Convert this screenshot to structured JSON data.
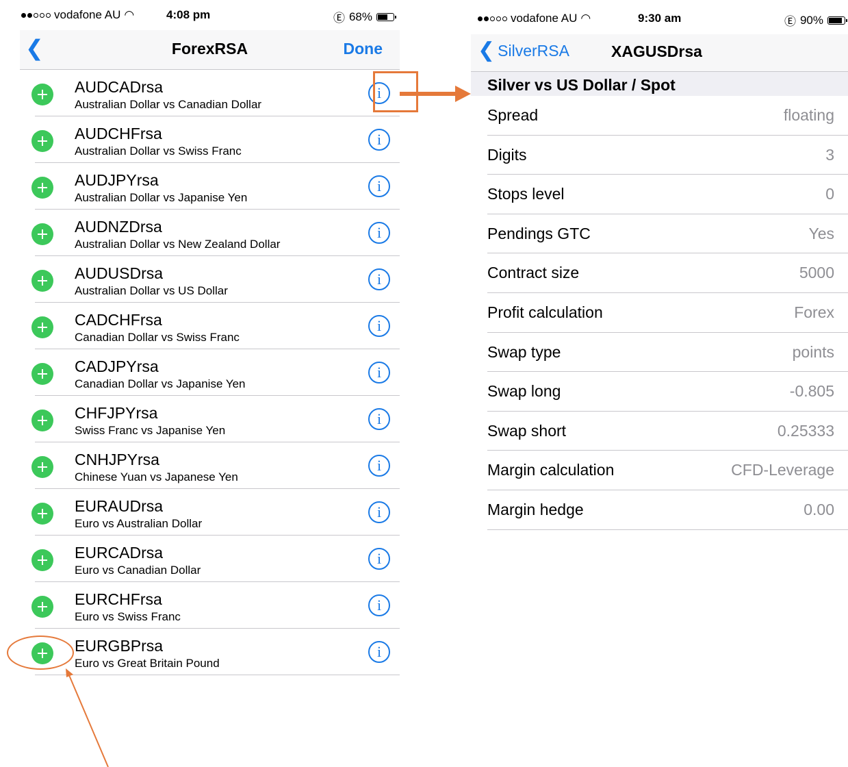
{
  "colors": {
    "accent": "#1a7ae6",
    "add_green": "#3cc85a",
    "annotation": "#e5793a",
    "value_gray": "#8e8e93"
  },
  "left_screen": {
    "status": {
      "carrier": "vodafone AU",
      "time": "4:08 pm",
      "battery": "68%",
      "battery_level": 0.68
    },
    "nav": {
      "back_icon": "chevron-left-icon",
      "title": "ForexRSA",
      "done_label": "Done"
    },
    "items": [
      {
        "symbol": "AUDCADrsa",
        "description": "Australian Dollar vs Canadian Dollar"
      },
      {
        "symbol": "AUDCHFrsa",
        "description": "Australian Dollar vs Swiss Franc"
      },
      {
        "symbol": "AUDJPYrsa",
        "description": "Australian Dollar vs Japanise Yen"
      },
      {
        "symbol": "AUDNZDrsa",
        "description": "Australian Dollar vs New Zealand Dollar"
      },
      {
        "symbol": "AUDUSDrsa",
        "description": "Australian Dollar vs US Dollar"
      },
      {
        "symbol": "CADCHFrsa",
        "description": "Canadian Dollar vs Swiss Franc"
      },
      {
        "symbol": "CADJPYrsa",
        "description": "Canadian Dollar vs Japanise Yen"
      },
      {
        "symbol": "CHFJPYrsa",
        "description": "Swiss Franc vs Japanise Yen"
      },
      {
        "symbol": "CNHJPYrsa",
        "description": "Chinese Yuan vs Japanese Yen"
      },
      {
        "symbol": "EURAUDrsa",
        "description": "Euro vs Australian Dollar"
      },
      {
        "symbol": "EURCADrsa",
        "description": "Euro vs Canadian Dollar"
      },
      {
        "symbol": "EURCHFrsa",
        "description": "Euro vs Swiss Franc"
      },
      {
        "symbol": "EURGBPrsa",
        "description": "Euro vs Great Britain Pound"
      }
    ],
    "info_glyph": "i"
  },
  "right_screen": {
    "status": {
      "carrier": "vodafone AU",
      "time": "9:30 am",
      "battery": "90%",
      "battery_level": 0.9
    },
    "nav": {
      "back_label": "SilverRSA",
      "title": "XAGUSDrsa"
    },
    "section_title": "Silver vs US Dollar / Spot",
    "properties": [
      {
        "label": "Spread",
        "value": "floating"
      },
      {
        "label": "Digits",
        "value": "3"
      },
      {
        "label": "Stops level",
        "value": "0"
      },
      {
        "label": "Pendings GTC",
        "value": "Yes"
      },
      {
        "label": "Contract size",
        "value": "5000"
      },
      {
        "label": "Profit calculation",
        "value": "Forex"
      },
      {
        "label": "Swap type",
        "value": "points"
      },
      {
        "label": "Swap long",
        "value": "-0.805"
      },
      {
        "label": "Swap short",
        "value": "0.25333"
      },
      {
        "label": "Margin calculation",
        "value": "CFD-Leverage"
      },
      {
        "label": "Margin hedge",
        "value": "0.00"
      }
    ]
  }
}
